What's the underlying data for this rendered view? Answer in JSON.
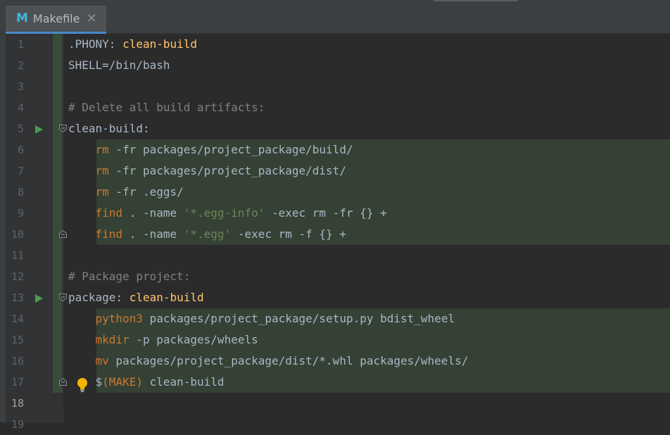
{
  "tab": {
    "icon": "M",
    "label": "Makefile",
    "close": "✕"
  },
  "lines": [
    {
      "number": "1",
      "tokens": [
        {
          "t": ".PHONY: ",
          "c": "plain"
        },
        {
          "t": "clean-build",
          "c": "tgt"
        }
      ]
    },
    {
      "number": "2",
      "tokens": [
        {
          "t": "SHELL=/bin/bash",
          "c": "plain"
        }
      ]
    },
    {
      "number": "3",
      "tokens": []
    },
    {
      "number": "4",
      "tokens": [
        {
          "t": "# Delete all build artifacts:",
          "c": "cm"
        }
      ]
    },
    {
      "number": "5",
      "tokens": [
        {
          "t": "clean-build:",
          "c": "plain"
        }
      ]
    },
    {
      "number": "6",
      "tokens": [
        {
          "t": "    ",
          "c": "plain"
        },
        {
          "t": "rm",
          "c": "kw"
        },
        {
          "t": " -fr packages/project_package/build/",
          "c": "plain"
        }
      ]
    },
    {
      "number": "7",
      "tokens": [
        {
          "t": "    ",
          "c": "plain"
        },
        {
          "t": "rm",
          "c": "kw"
        },
        {
          "t": " -fr packages/project_package/dist/",
          "c": "plain"
        }
      ]
    },
    {
      "number": "8",
      "tokens": [
        {
          "t": "    ",
          "c": "plain"
        },
        {
          "t": "rm",
          "c": "kw"
        },
        {
          "t": " -fr .eggs/",
          "c": "plain"
        }
      ]
    },
    {
      "number": "9",
      "tokens": [
        {
          "t": "    ",
          "c": "plain"
        },
        {
          "t": "find",
          "c": "kw"
        },
        {
          "t": " . -name ",
          "c": "plain"
        },
        {
          "t": "'*.egg-info'",
          "c": "str"
        },
        {
          "t": " -exec rm -fr {} +",
          "c": "plain"
        }
      ]
    },
    {
      "number": "10",
      "tokens": [
        {
          "t": "    ",
          "c": "plain"
        },
        {
          "t": "find",
          "c": "kw"
        },
        {
          "t": " . -name ",
          "c": "plain"
        },
        {
          "t": "'*.egg'",
          "c": "str"
        },
        {
          "t": " -exec rm -f {} +",
          "c": "plain"
        }
      ]
    },
    {
      "number": "11",
      "tokens": []
    },
    {
      "number": "12",
      "tokens": [
        {
          "t": "# Package project:",
          "c": "cm"
        }
      ]
    },
    {
      "number": "13",
      "tokens": [
        {
          "t": "package: ",
          "c": "plain"
        },
        {
          "t": "clean-build",
          "c": "tgt"
        }
      ]
    },
    {
      "number": "14",
      "tokens": [
        {
          "t": "    ",
          "c": "plain"
        },
        {
          "t": "python3",
          "c": "kw"
        },
        {
          "t": " packages/project_package/setup.py bdist_wheel",
          "c": "plain"
        }
      ]
    },
    {
      "number": "15",
      "tokens": [
        {
          "t": "    ",
          "c": "plain"
        },
        {
          "t": "mkdir",
          "c": "kw"
        },
        {
          "t": " -p packages/wheels",
          "c": "plain"
        }
      ]
    },
    {
      "number": "16",
      "tokens": [
        {
          "t": "    ",
          "c": "plain"
        },
        {
          "t": "mv",
          "c": "kw"
        },
        {
          "t": " packages/project_package/dist/*.whl packages/wheels/",
          "c": "plain"
        }
      ]
    },
    {
      "number": "17",
      "tokens": [
        {
          "t": "    ",
          "c": "plain"
        },
        {
          "t": "$",
          "c": "plain"
        },
        {
          "t": "(MAKE)",
          "c": "kw"
        },
        {
          "t": " clean-build",
          "c": "plain"
        }
      ]
    },
    {
      "number": "18",
      "tokens": []
    },
    {
      "number": "19",
      "tokens": []
    }
  ],
  "current_line": "18",
  "colors": {
    "background": "#2b2b2b",
    "gutter": "#313335",
    "keyword": "#cc7832",
    "target": "#ffc66d",
    "comment": "#808080",
    "string": "#6a8759",
    "text": "#a9b7c6",
    "run_icon": "#499c54",
    "change_marker": "#384c38",
    "recipe_highlight": "#344134"
  },
  "icons": {
    "tab_icon": "makefile-icon",
    "run": "run-target-icon",
    "fold": "fold-marker-icon",
    "intention": "lightbulb-icon"
  }
}
